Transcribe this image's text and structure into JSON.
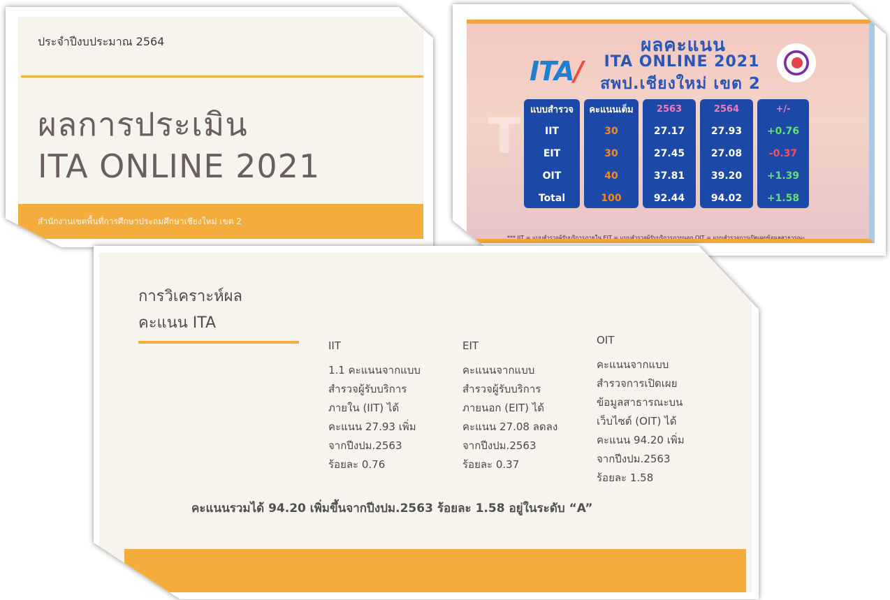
{
  "slide1": {
    "budget_year": "ประจำปีงบประมาณ 2564",
    "title_line1": "ผลการประเมิน",
    "title_line2": "ITA ONLINE 2021",
    "footer": "สำนักงานเขตพื้นที่การศึกษาประถมศึกษาเชียงใหม่ เขต 2"
  },
  "slide2": {
    "logo_text": "ITA",
    "watermark": "TO",
    "heading_line1": "ผลคะแนน",
    "heading_line2": "ITA ONLINE 2021",
    "heading_line3": "สพป.เชียงใหม่ เขต 2",
    "table": {
      "headers": [
        "แบบสำรวจ",
        "คะแนนเต็ม",
        "2563",
        "2564",
        "+/-"
      ],
      "rows": [
        [
          "IIT",
          "30",
          "27.17",
          "27.93",
          "+0.76"
        ],
        [
          "EIT",
          "30",
          "27.45",
          "27.08",
          "-0.37"
        ],
        [
          "OIT",
          "40",
          "37.81",
          "39.20",
          "+1.39"
        ],
        [
          "Total",
          "100",
          "92.44",
          "94.02",
          "+1.58"
        ]
      ]
    },
    "footnote": "*** IIT = แบบสำรวจผู้รับบริการภายใน  EIT = แบบสำรวจผู้รับบริการภายนอก  OIT = แบบสำรวจการเปิดเผยข้อมูลสาธารณะ",
    "colors": {
      "header_blue": "#2a57b6",
      "cell_blue": "#1c49a8",
      "full_orange": "#f28a1e",
      "year_pink": "#f27ab8",
      "positive_green": "#66e07a",
      "negative_red": "#ff4f55"
    }
  },
  "slide3": {
    "title_line1": "การวิเคราะห์ผล",
    "title_line2": "คะแนน ITA",
    "iit": {
      "head": "IIT",
      "lines": [
        "1.1 คะแนนจากแบบ",
        "สำรวจผู้รับบริการ",
        "ภายใน (IIT) ได้",
        "คะแนน 27.93 เพิ่ม",
        "จากปีงปม.2563",
        "ร้อยละ 0.76"
      ]
    },
    "eit": {
      "head": "EIT",
      "lines": [
        "คะแนนจากแบบ",
        "สำรวจผู้รับบริการ",
        "ภายนอก (EIT) ได้",
        "คะแนน 27.08 ลดลง",
        "จากปีงปม.2563",
        "ร้อยละ 0.37"
      ]
    },
    "oit": {
      "head": "OIT",
      "lines": [
        "คะแนนจากแบบ",
        "สำรวจการเปิดเผย",
        "ข้อมูลสาธารณะบน",
        "เว็บไซต์ (OIT) ได้",
        "คะแนน 94.20 เพิ่ม",
        "จากปีงปม.2563",
        "ร้อยละ 1.58"
      ]
    },
    "summary": "คะแนนรวมได้ 94.20 เพิ่มขึ้นจากปีงปม.2563 ร้อยละ 1.58 อยู่ในระดับ “A”"
  },
  "colors": {
    "accent_orange": "#f4ad3c",
    "panel_bg": "#f7f4ee",
    "title_text": "#6b5e5e"
  }
}
